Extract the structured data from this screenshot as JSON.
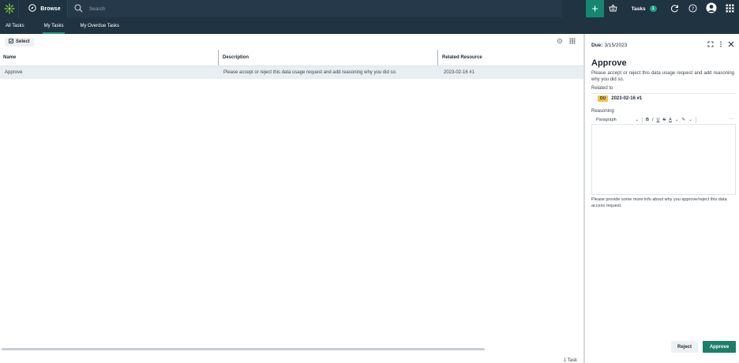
{
  "topbar": {
    "browse_label": "Browse",
    "search_placeholder": "Search",
    "tasks_label": "Tasks",
    "tasks_count": "1"
  },
  "subnav": {
    "tabs": [
      {
        "label": "All Tasks"
      },
      {
        "label": "My Tasks"
      },
      {
        "label": "My Overdue Tasks"
      }
    ]
  },
  "list": {
    "select_label": "Select",
    "columns": [
      "Name",
      "Description",
      "Related Resource"
    ],
    "rows": [
      {
        "name": "Approve",
        "description": "Please accept or reject this data usage request and add reasoning why you did so.",
        "related": "2023-02-16 #1"
      }
    ],
    "count_text": "1 Task"
  },
  "detail": {
    "due_label": "Due:",
    "due_date": "3/15/2023",
    "title": "Approve",
    "description": "Please accept or reject this data usage request and add reasoning why you did so.",
    "related_label": "Related to",
    "related_badge": "DU",
    "related_value": "2023-02-16 #1",
    "reasoning_label": "Reasoning",
    "paragraph_select": "Paragraph",
    "hint": "Please provide some more info about why you approve/reject this data access request.",
    "reject_label": "Reject",
    "approve_label": "Approve"
  },
  "colors": {
    "nav_bg": "#1f3341",
    "accent": "#17a383",
    "approve_bg": "#1c7f6a",
    "badge_yellow": "#f2c14e"
  }
}
